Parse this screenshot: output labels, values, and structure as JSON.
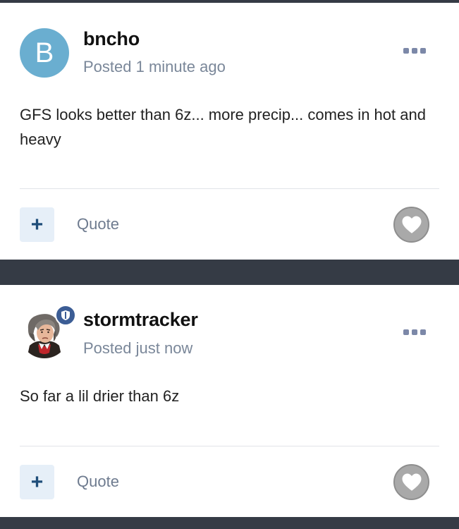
{
  "posts": [
    {
      "author": "bncho",
      "avatar_letter": "B",
      "avatar_color": "#6aaed0",
      "posted": "Posted 1 minute ago",
      "content": "GFS looks better than 6z... more precip... comes in hot and heavy",
      "quote_label": "Quote",
      "plus_label": "+"
    },
    {
      "author": "stormtracker",
      "avatar_icon": "beethoven-portrait-avatar",
      "badge_icon": "moderator-shield-icon",
      "posted": "Posted just now",
      "content": "So far a lil drier than 6z",
      "quote_label": "Quote",
      "plus_label": "+"
    }
  ],
  "colors": {
    "background": "#353b45",
    "card": "#ffffff",
    "meta_text": "#7a8799",
    "plus_button_bg": "#e6eff8",
    "plus_button_fg": "#1f4e7a",
    "like_button": "#a9a9a9",
    "badge": "#3c5d95"
  }
}
